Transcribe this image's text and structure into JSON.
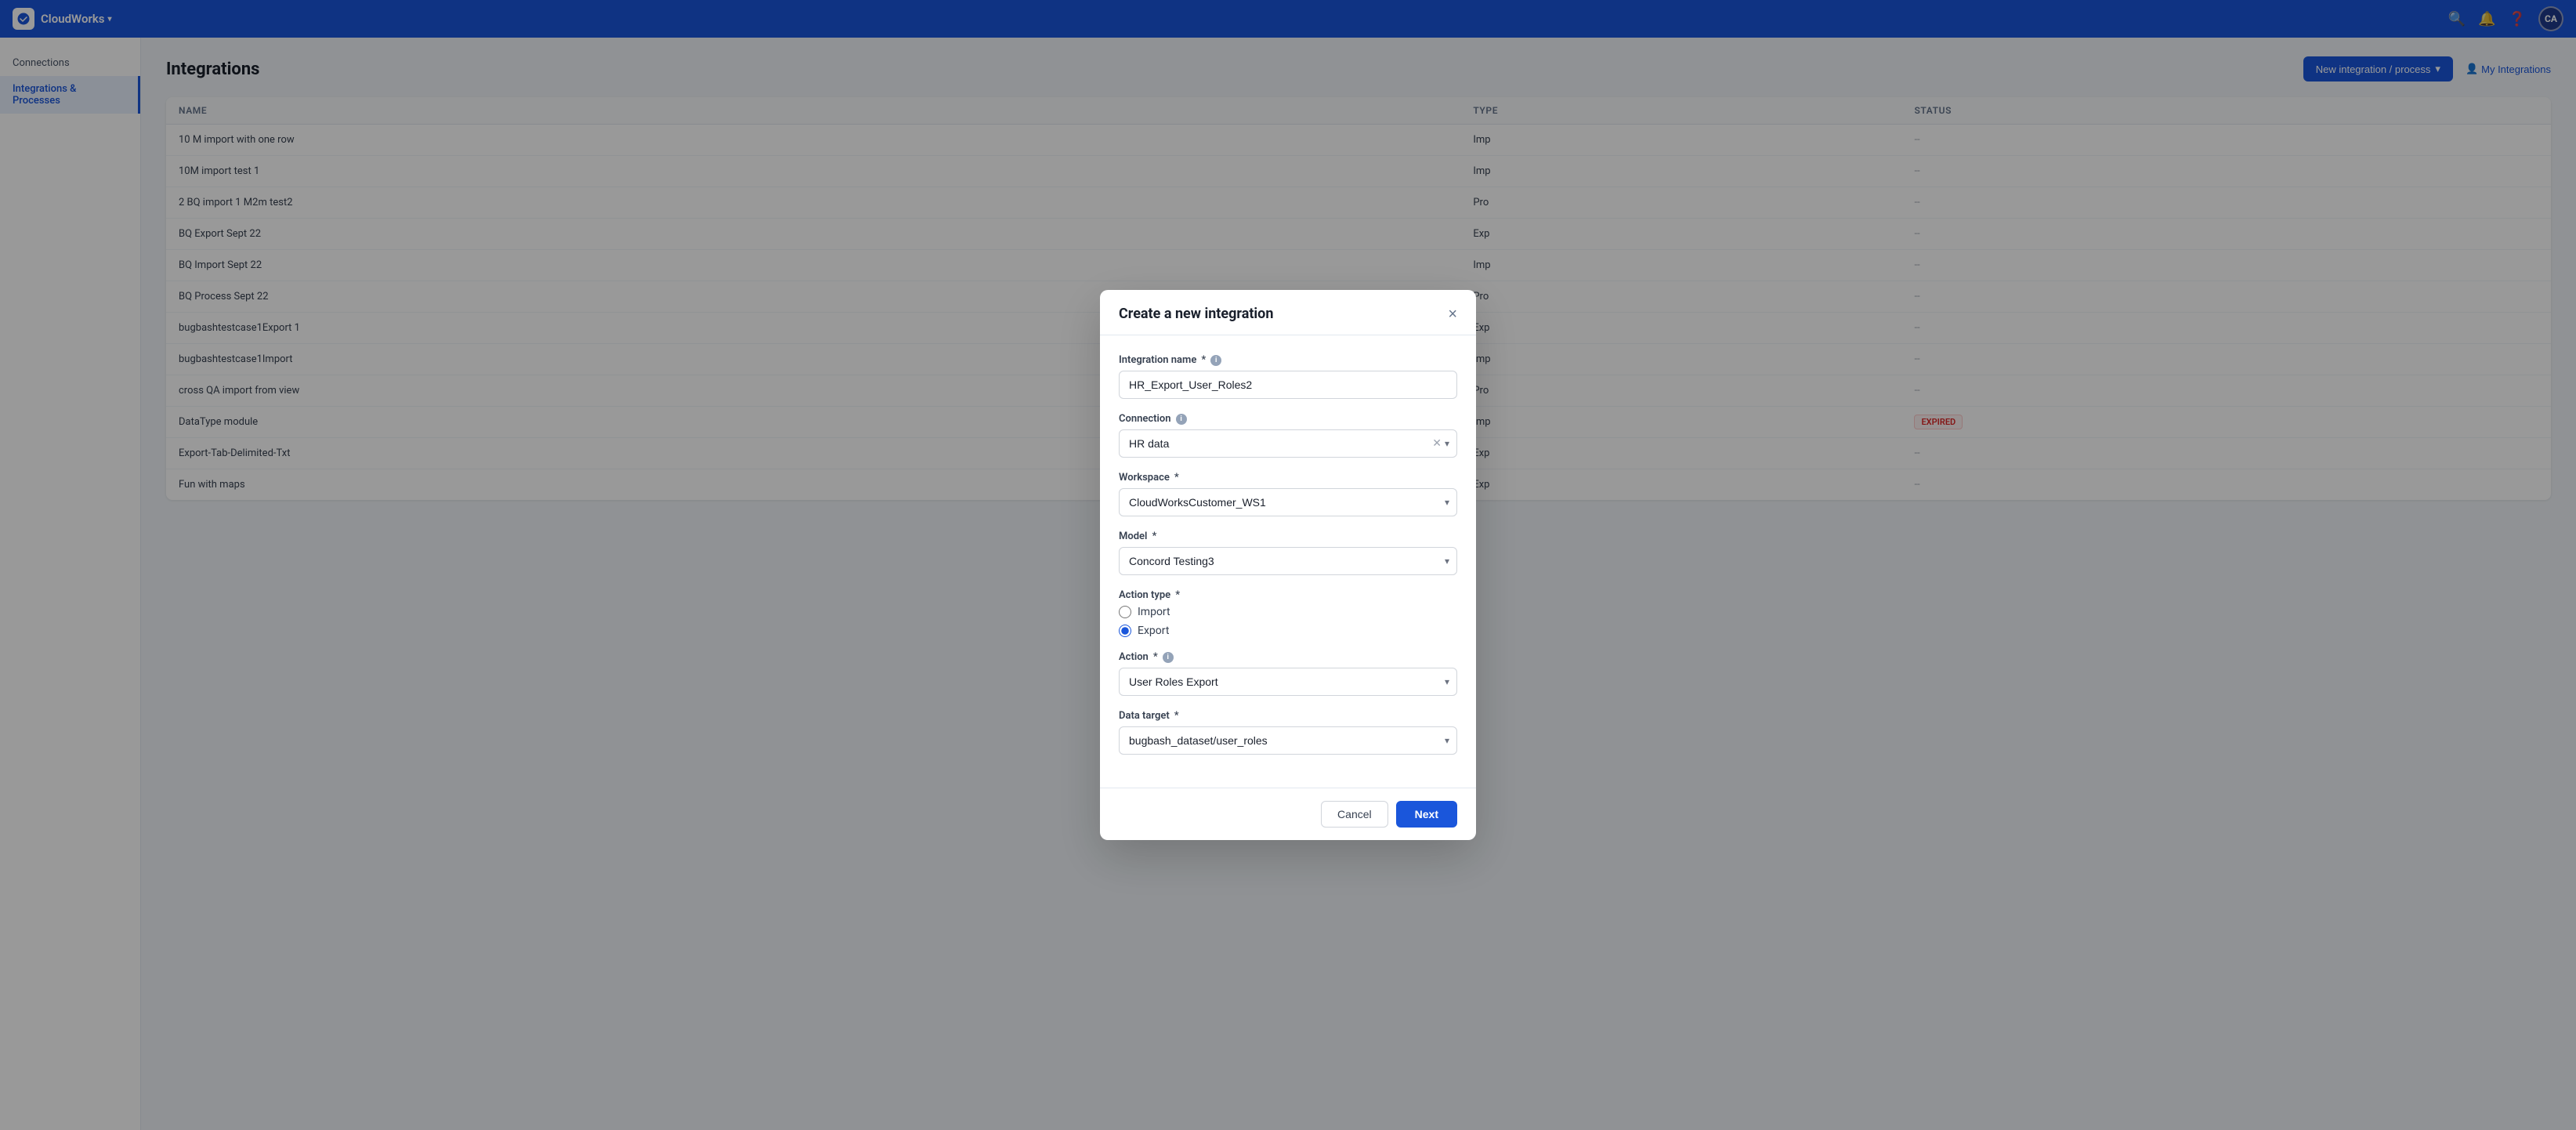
{
  "app": {
    "name": "CloudWorks",
    "chevron": "▾"
  },
  "topnav": {
    "avatar_label": "CA",
    "new_integration_button": "New integration / process",
    "new_integration_chevron": "▾",
    "my_integrations_label": "My Integrations"
  },
  "sidebar": {
    "items": [
      {
        "id": "connections",
        "label": "Connections",
        "active": false
      },
      {
        "id": "integrations-processes",
        "label": "Integrations & Processes",
        "active": true
      }
    ]
  },
  "page": {
    "title": "Integrations"
  },
  "table": {
    "columns": [
      "Name",
      "Type",
      "Status"
    ],
    "rows": [
      {
        "name": "10 M import with one row",
        "type": "Imp",
        "status": "--"
      },
      {
        "name": "10M import test 1",
        "type": "Imp",
        "status": "--"
      },
      {
        "name": "2 BQ import 1 M2m test2",
        "type": "Pro",
        "status": "--"
      },
      {
        "name": "BQ Export Sept 22",
        "type": "Exp",
        "status": "--"
      },
      {
        "name": "BQ Import Sept 22",
        "type": "Imp",
        "status": "--"
      },
      {
        "name": "BQ Process Sept 22",
        "type": "Pro",
        "status": "--"
      },
      {
        "name": "bugbashtestcase1Export 1",
        "type": "Exp",
        "status": "--"
      },
      {
        "name": "bugbashtestcase1Import",
        "type": "Imp",
        "status": "--"
      },
      {
        "name": "cross QA import from view",
        "type": "Pro",
        "status": "--"
      },
      {
        "name": "DataType module",
        "type": "Imp",
        "status": "EXPIRED"
      },
      {
        "name": "Export-Tab-Delimited-Txt",
        "type": "Exp",
        "status": "--"
      },
      {
        "name": "Fun with maps",
        "type": "Exp",
        "status": "--"
      }
    ]
  },
  "modal": {
    "title": "Create a new integration",
    "close_label": "×",
    "fields": {
      "integration_name": {
        "label": "Integration name",
        "required": true,
        "info": true,
        "value": "HR_Export_User_Roles2"
      },
      "connection": {
        "label": "Connection",
        "info": true,
        "value": "HR data",
        "options": [
          "HR data"
        ]
      },
      "workspace": {
        "label": "Workspace",
        "required": true,
        "value": "CloudWorksCustomer_WS1",
        "options": [
          "CloudWorksCustomer_WS1"
        ]
      },
      "model": {
        "label": "Model",
        "required": true,
        "value": "Concord Testing3",
        "options": [
          "Concord Testing3"
        ]
      },
      "action_type": {
        "label": "Action type",
        "required": true,
        "options": [
          {
            "value": "import",
            "label": "Import",
            "selected": false
          },
          {
            "value": "export",
            "label": "Export",
            "selected": true
          }
        ]
      },
      "action": {
        "label": "Action",
        "required": true,
        "info": true,
        "value": "User Roles Export",
        "options": [
          "User Roles Export"
        ]
      },
      "data_target": {
        "label": "Data target",
        "required": true,
        "value": "bugbash_dataset/user_roles",
        "options": [
          "bugbash_dataset/user_roles"
        ]
      }
    },
    "cancel_label": "Cancel",
    "next_label": "Next"
  }
}
